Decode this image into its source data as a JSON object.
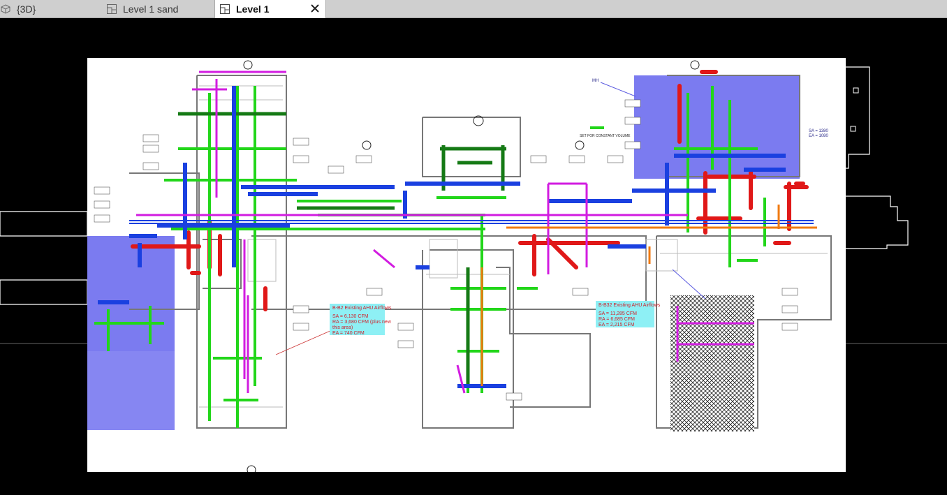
{
  "tabs": [
    {
      "label": "{3D}",
      "icon": "cube-icon",
      "active": false
    },
    {
      "label": "Level 1 sand",
      "icon": "floor-plan-icon",
      "active": false
    },
    {
      "label": "Level 1",
      "icon": "floor-plan-icon",
      "active": true
    }
  ],
  "close_symbol": "✕",
  "callouts": {
    "left": {
      "title": "B-B2 Existing AHU Airflows",
      "sa": "SA = 6,130 CFM",
      "ra": "RA = 3,680 CFM (plus new",
      "ra_cont": "this area)",
      "ea": "EA = 740 CFM"
    },
    "right": {
      "title": "B-B32 Existing AHU Airflows",
      "sa": "SA = 11,285 CFM",
      "ra": "RA = 6,685 CFM",
      "ea": "EA = 2,215 CFM"
    }
  },
  "right_labels": {
    "sa": "SA = 1380",
    "ea": "EA = 1080"
  },
  "markers": {
    "top_center": "MH",
    "constant_volume": "SET FOR CONSTANT VOLUME"
  },
  "colors": {
    "supply_duct": "#1a40e0",
    "return_duct": "#e01818",
    "exhaust_duct": "#22d61a",
    "dark_green_duct": "#157a15",
    "magenta_duct": "#d21ce0",
    "orange_duct": "#f07a10",
    "zone_fill": "#7b7bf0",
    "callout_bg": "#8ef0f5"
  }
}
